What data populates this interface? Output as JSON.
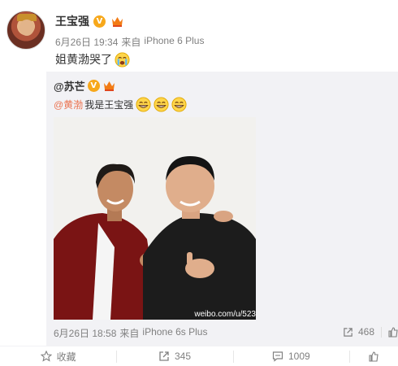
{
  "post": {
    "author": "王宝强",
    "date": "6月26日 19:34",
    "source_prefix": "来自",
    "source": "iPhone 6 Plus",
    "text": "姐黄渤哭了"
  },
  "repost": {
    "author": "@苏芒",
    "mention": "@黄渤",
    "text": " 我是王宝强",
    "watermark": "weibo.com/u/523",
    "date": "6月26日 18:58",
    "source_prefix": "来自",
    "source": "iPhone 6s Plus",
    "repost_count": "468"
  },
  "actions": {
    "favorite_label": "收藏",
    "repost_count": "345",
    "comment_count": "1009"
  },
  "icons": [
    "verified-v-icon",
    "vip-member-icon",
    "crying-emoji-icon",
    "grin-emoji-icon",
    "favorite-star-icon",
    "repost-icon",
    "comment-icon",
    "like-thumb-icon"
  ],
  "colors": {
    "verified": "#f7a81b",
    "mention": "#eb7350",
    "meta": "#808080",
    "repost_bg": "#f2f2f5"
  }
}
